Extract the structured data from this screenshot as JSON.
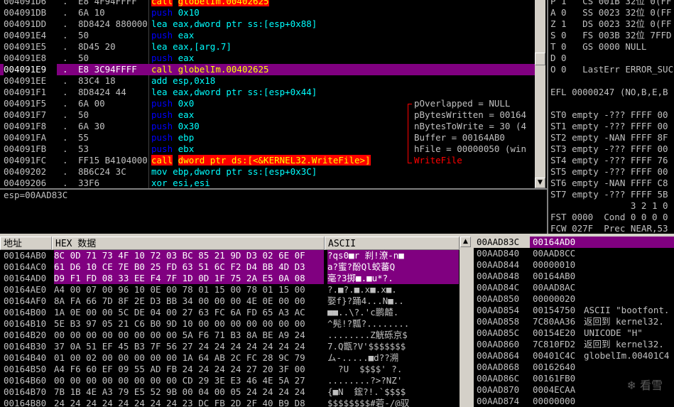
{
  "cpu": {
    "selected_index": 6,
    "rows": [
      {
        "addr": "004091D6",
        "dot": ".",
        "hex": "E8 4F94FFFF",
        "op": "call",
        "operands": "globelIm.00402625",
        "optype": "call"
      },
      {
        "addr": "004091DB",
        "dot": ".",
        "hex": "6A 10",
        "op": "push",
        "operands": "0x10",
        "optype": "push"
      },
      {
        "addr": "004091DD",
        "dot": ".",
        "hex": "8D8424 880000",
        "op": "lea",
        "operands": "eax,dword ptr ss:[esp+0x88]",
        "optype": "default"
      },
      {
        "addr": "004091E4",
        "dot": ".",
        "hex": "50",
        "op": "push",
        "operands": "eax",
        "optype": "push"
      },
      {
        "addr": "004091E5",
        "dot": ".",
        "hex": "8D45 20",
        "op": "lea",
        "operands": "eax,[arg.7]",
        "optype": "default"
      },
      {
        "addr": "004091E8",
        "dot": ".",
        "hex": "50",
        "op": "push",
        "operands": "eax",
        "optype": "push"
      },
      {
        "addr": "004091E9",
        "dot": ".",
        "hex": "E8 3C94FFFF",
        "op": "call",
        "operands": "globelIm.00402625",
        "optype": "call"
      },
      {
        "addr": "004091EE",
        "dot": ".",
        "hex": "83C4 18",
        "op": "add",
        "operands": "esp,0x18",
        "optype": "default"
      },
      {
        "addr": "004091F1",
        "dot": ".",
        "hex": "8D8424 44",
        "op": "lea",
        "operands": "eax,dword ptr ss:[esp+0x44]",
        "optype": "default"
      },
      {
        "addr": "004091F5",
        "dot": ".",
        "hex": "6A 00",
        "op": "push",
        "operands": "0x0",
        "optype": "push"
      },
      {
        "addr": "004091F7",
        "dot": ".",
        "hex": "50",
        "op": "push",
        "operands": "eax",
        "optype": "push"
      },
      {
        "addr": "004091F8",
        "dot": ".",
        "hex": "6A 30",
        "op": "push",
        "operands": "0x30",
        "optype": "push"
      },
      {
        "addr": "004091FA",
        "dot": ".",
        "hex": "55",
        "op": "push",
        "operands": "ebp",
        "optype": "push"
      },
      {
        "addr": "004091FB",
        "dot": ".",
        "hex": "53",
        "op": "push",
        "operands": "ebx",
        "optype": "push"
      },
      {
        "addr": "004091FC",
        "dot": ".",
        "hex": "FF15 B4104000",
        "op": "call",
        "operands": "dword ptr ds:[<&KERNEL32.WriteFile>]",
        "optype": "call"
      },
      {
        "addr": "00409202",
        "dot": ".",
        "hex": "8B6C24 3C",
        "op": "mov",
        "operands": "ebp,dword ptr ss:[esp+0x3C]",
        "optype": "default"
      },
      {
        "addr": "00409206",
        "dot": ".",
        "hex": "33F6",
        "op": "xor",
        "operands": "esi,esi",
        "optype": "default"
      }
    ],
    "args": [
      {
        "text": "pOverlapped = NULL",
        "cls": ""
      },
      {
        "text": "pBytesWritten = 00164",
        "cls": ""
      },
      {
        "text": "nBytesToWrite = 30 (4",
        "cls": ""
      },
      {
        "text": "Buffer = 00164AB0",
        "cls": ""
      },
      {
        "text": "hFile = 00000050 (win",
        "cls": ""
      },
      {
        "text": "WriteFile",
        "cls": "fn"
      }
    ],
    "args_start_index": 9
  },
  "info_line": "esp=00AAD83C",
  "registers": [
    "P 1   CS 001B 32位 0(FF",
    "A 0   SS 0023 32位 0(FF",
    "Z 1   DS 0023 32位 0(FF",
    "S 0   FS 003B 32位 7FFD",
    "T 0   GS 0000 NULL",
    "D 0",
    "O 0   LastErr ERROR_SUC",
    "",
    "EFL 00000247 (NO,B,E,B",
    "",
    "ST0 empty -??? FFFF 00",
    "ST1 empty -??? FFFF 00",
    "ST2 empty -NAN FFFF 8F",
    "ST3 empty -??? FFFF 00",
    "ST4 empty -??? FFFF 76",
    "ST5 empty -??? FFFF 00",
    "ST6 empty -NAN FFFF C8",
    "ST7 empty -??? FFFF 5B",
    "               3 2 1 0",
    "FST 0000  Cond 0 0 0 0",
    "FCW 027F  Prec NEAR,53"
  ],
  "dump": {
    "headers": {
      "addr": "地址",
      "hex": "HEX 数据",
      "ascii": "ASCII"
    },
    "selected_rows": [
      0,
      1,
      2
    ],
    "rows": [
      {
        "addr": "00164AB0",
        "hex": "8C 0D 71 73 4F 10 72 03 BC 85 21 9D D3 02 6E 0F",
        "asc": "?qs0■r 刹!潦-n■"
      },
      {
        "addr": "00164AC0",
        "hex": "61 D6 10 CE 7E B0 25 FD 63 51 6C F2 D4 BB 4D D3",
        "asc": "a?蜜?酚Ql蛟蕃Q"
      },
      {
        "addr": "00164AD0",
        "hex": "D9 F1 FD 08 33 EE F4 7F 1D 0D 1F 75 2A E5 0A 08",
        "asc": "毫?3掷■.■u*?."
      },
      {
        "addr": "00164AE0",
        "hex": "A4 00 07 00 96 10 0E 00 78 01 15 00 78 01 15 00",
        "asc": "?.■?.■.x■.x■."
      },
      {
        "addr": "00164AF0",
        "hex": "8A FA 66 7D 8F 2E D3 BB 34 00 00 00 4E 0E 00 00",
        "asc": "娶f}?踊4...N■.."
      },
      {
        "addr": "00164B00",
        "hex": "1A 0E 00 00 5C DE 04 00 27 63 FC 6A FD 65 A3 AC",
        "asc": "■■..\\?.'c鹏齄."
      },
      {
        "addr": "00164B10",
        "hex": "5E B3 97 05 21 C6 B0 9D 10 00 00 00 00 00 00 00",
        "asc": "^髡!?瓢?........"
      },
      {
        "addr": "00164B20",
        "hex": "00 00 00 00 00 00 00 00 5A F6 71 B3 8A BE A9 24",
        "asc": "........Z觥砾京$"
      },
      {
        "addr": "00164B30",
        "hex": "37 0A 51 EF 45 B3 7F 56 27 24 24 24 24 24 24 24",
        "asc": "7.Q甑?V'$$$$$$$"
      },
      {
        "addr": "00164B40",
        "hex": "01 00 02 00 00 00 00 00 1A 64 AB 2C FC 28 9C 79",
        "asc": "ム-.....■d??溯"
      },
      {
        "addr": "00164B50",
        "hex": "A4 F6 60 EF 09 55 AD FB 24 24 24 24 27 20 3F 00",
        "asc": "  ?U  $$$$' ?."
      },
      {
        "addr": "00164B60",
        "hex": "00 00 00 00 00 00 00 00 CD 29 3E E3 46 4E 5A 27",
        "asc": "........?>?NZ'"
      },
      {
        "addr": "00164B70",
        "hex": "7B 1B 4E A3 79 E5 52 9B 00 04 00 05 24 24 24 24",
        "asc": "{■N  鋐?!.`$$$$"
      },
      {
        "addr": "00164B80",
        "hex": "24 24 24 24 24 24 24 24 23 DC FB 2D 2F 40 B9 D8",
        "asc": "$$$$$$$$#菪-/@驭"
      }
    ]
  },
  "stack": {
    "rows": [
      {
        "addr": "00AAD83C",
        "val": "00164AD0",
        "com": "",
        "sel": true
      },
      {
        "addr": "00AAD840",
        "val": "00AAD8CC",
        "com": ""
      },
      {
        "addr": "00AAD844",
        "val": "00000010",
        "com": ""
      },
      {
        "addr": "00AAD848",
        "val": "00164AB0",
        "com": ""
      },
      {
        "addr": "00AAD84C",
        "val": "00AAD8AC",
        "com": ""
      },
      {
        "addr": "00AAD850",
        "val": "00000020",
        "com": ""
      },
      {
        "addr": "00AAD854",
        "val": "00154750",
        "com": "ASCII \"bootfont."
      },
      {
        "addr": "00AAD858",
        "val": "7C80AA36",
        "com": "返回到 kernel32."
      },
      {
        "addr": "00AAD85C",
        "val": "00154E20",
        "com": "UNICODE \"H\""
      },
      {
        "addr": "00AAD860",
        "val": "7C810FD2",
        "com": "返回到 kernel32."
      },
      {
        "addr": "00AAD864",
        "val": "00401C4C",
        "com": "globelIm.00401C4"
      },
      {
        "addr": "00AAD868",
        "val": "00162640",
        "com": ""
      },
      {
        "addr": "00AAD86C",
        "val": "00161FB0",
        "com": ""
      },
      {
        "addr": "00AAD870",
        "val": "0004ECAA",
        "com": ""
      },
      {
        "addr": "00AAD874",
        "val": "00000000",
        "com": ""
      }
    ]
  },
  "watermark": "❄ 看雪",
  "colors": {
    "selection": "#800080",
    "call_bg": "#ff0000",
    "call_fg": "#ffff00",
    "push": "#0000ff",
    "operand": "#00ffff",
    "panel_bg": "#000000"
  }
}
